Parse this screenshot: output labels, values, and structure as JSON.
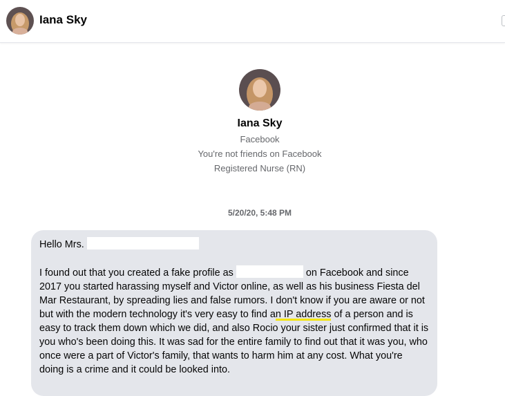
{
  "header": {
    "name": "Iana Sky"
  },
  "profile": {
    "name": "Iana Sky",
    "platform": "Facebook",
    "friend_status": "You're not friends on Facebook",
    "occupation": "Registered Nurse (RN)"
  },
  "thread": {
    "timestamp": "5/20/20, 5:48 PM"
  },
  "message": {
    "greeting": "Hello Mrs.",
    "body_part1": "I found out that you created a fake profile as",
    "body_part2": "on Facebook and since 2017 you started harassing myself and Victor online, as well as his business Fiesta del Mar Restaurant, by spreading lies and false rumors. I don't know if you are aware or not but with the modern technology it's very easy to find a",
    "highlight": "n IP address",
    "body_part3": "of a person and is easy to track them down which we did, and also Rocio your sister just confirmed that it is you who's been doing this.  It was sad for the entire family to find out that it was you, who once were a part of Victor's family, that wants to harm him at any cost. What you're doing is a crime and it could be looked into."
  },
  "colors": {
    "bubble": "#e4e6eb",
    "secondary_text": "#65676b",
    "highlight": "#f4e500"
  },
  "icons": {
    "avatar": "profile-photo"
  }
}
